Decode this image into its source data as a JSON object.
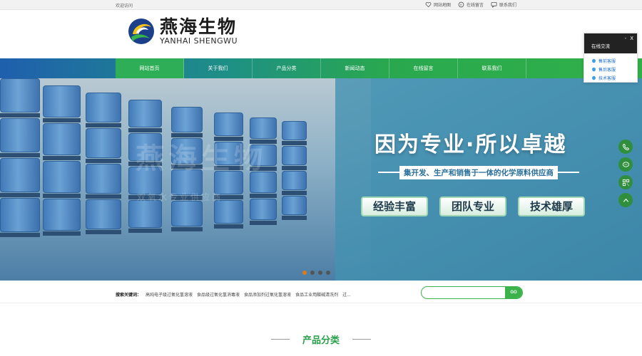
{
  "topbar": {
    "welcome": "欢迎访问",
    "links": [
      {
        "label": "网站地图",
        "icon": "heart-icon"
      },
      {
        "label": "在线留言",
        "icon": "message-icon"
      },
      {
        "label": "联系我们",
        "icon": "chat-icon"
      }
    ]
  },
  "header": {
    "logo_cn": "燕海生物",
    "logo_en": "YANHAI SHENGWU"
  },
  "nav": {
    "items": [
      {
        "label": "网站首页",
        "active": true
      },
      {
        "label": "关于我们"
      },
      {
        "label": "产品分类"
      },
      {
        "label": "新闻动态"
      },
      {
        "label": "在线留言"
      },
      {
        "label": "联系我们"
      }
    ]
  },
  "banner": {
    "slogan": "因为专业·所以卓越",
    "sub_slogan": "集开发、生产和销售于一体的化学原料供应商",
    "badges": [
      "经验丰富",
      "团队专业",
      "技术雄厚"
    ],
    "ghost_text": "燕海生物",
    "ghost_sub": "双氧水专业供应商",
    "slide_count": 4,
    "active_slide": 0
  },
  "search": {
    "keywords_label": "搜索关键词：",
    "keywords": [
      "高纯电子级过氧化氢溶液",
      "食品级过氧化氢消毒液",
      "食品添加剂过氧化氢溶液",
      "食品工业用酸碱清洗剂",
      "过..."
    ],
    "placeholder": "",
    "button_label": "GO"
  },
  "section": {
    "title": "产品分类"
  },
  "chat": {
    "title": "在线交流",
    "minimize": "-",
    "close": "X",
    "items": [
      "售前客服",
      "售后客服",
      "技术客服"
    ]
  },
  "side_buttons": [
    "phone-icon",
    "wechat-icon",
    "qrcode-icon",
    "back-to-top-icon"
  ],
  "colors": {
    "brand_green": "#31b04a",
    "nav_blue": "#1f5fae",
    "chat_blue": "#1a6fd1"
  }
}
